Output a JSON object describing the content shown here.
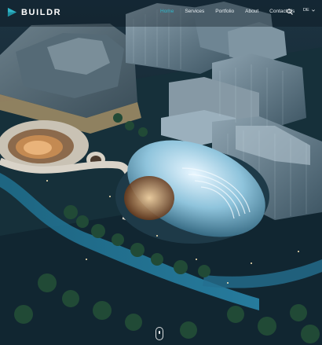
{
  "brand": {
    "name": "BUILDR",
    "accent": "#2fb6c8"
  },
  "nav": {
    "items": [
      {
        "label": "Home",
        "active": true
      },
      {
        "label": "Services",
        "active": false
      },
      {
        "label": "Portfolio",
        "active": false
      },
      {
        "label": "About",
        "active": false
      },
      {
        "label": "Contact Us",
        "active": false
      }
    ]
  },
  "language": {
    "selected": "DE"
  },
  "icons": {
    "search": "search-icon",
    "language_caret": "chevron-down-icon",
    "scroll": "mouse-scroll-icon"
  }
}
